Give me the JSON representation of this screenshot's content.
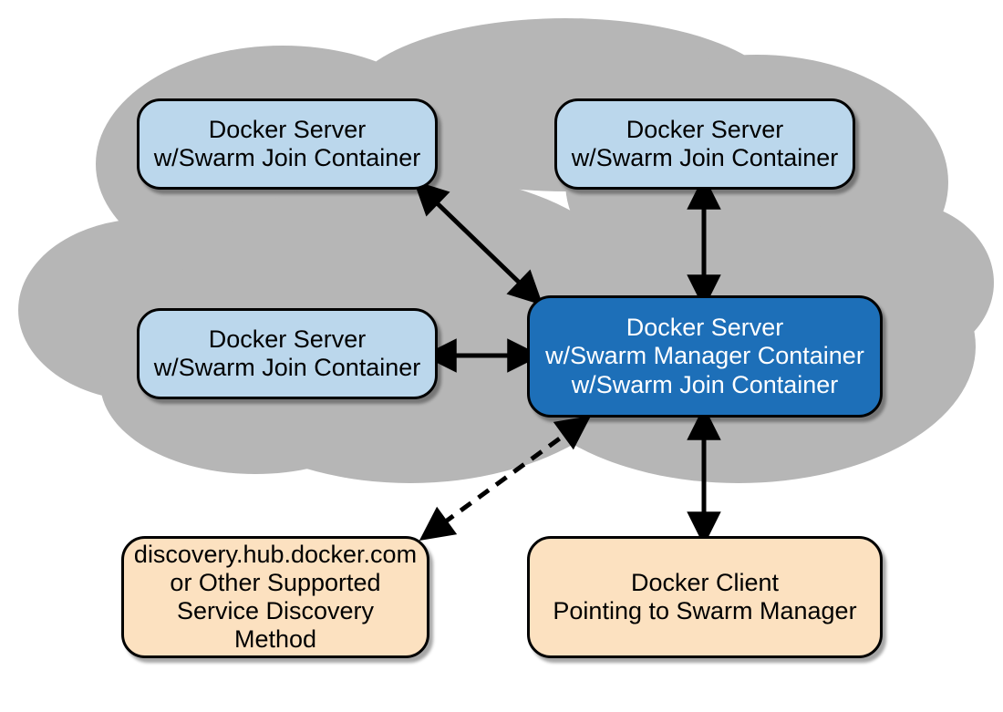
{
  "nodes": {
    "worker1": {
      "line1": "Docker Server",
      "line2": "w/Swarm Join Container"
    },
    "worker2": {
      "line1": "Docker Server",
      "line2": "w/Swarm Join Container"
    },
    "worker3": {
      "line1": "Docker Server",
      "line2": "w/Swarm Join Container"
    },
    "manager": {
      "line1": "Docker Server",
      "line2": "w/Swarm Manager Container",
      "line3": "w/Swarm Join Container"
    },
    "discovery": {
      "line1": "discovery.hub.docker.com",
      "line2": "or Other Supported",
      "line3": "Service Discovery Method"
    },
    "client": {
      "line1": "Docker Client",
      "line2": "Pointing to Swarm Manager"
    }
  },
  "colors": {
    "cloud": "#B6B6B6",
    "lightBlue": "#BBD7EC",
    "darkBlue": "#1D6FB8",
    "tan": "#FCE1C0",
    "border": "#000000"
  }
}
